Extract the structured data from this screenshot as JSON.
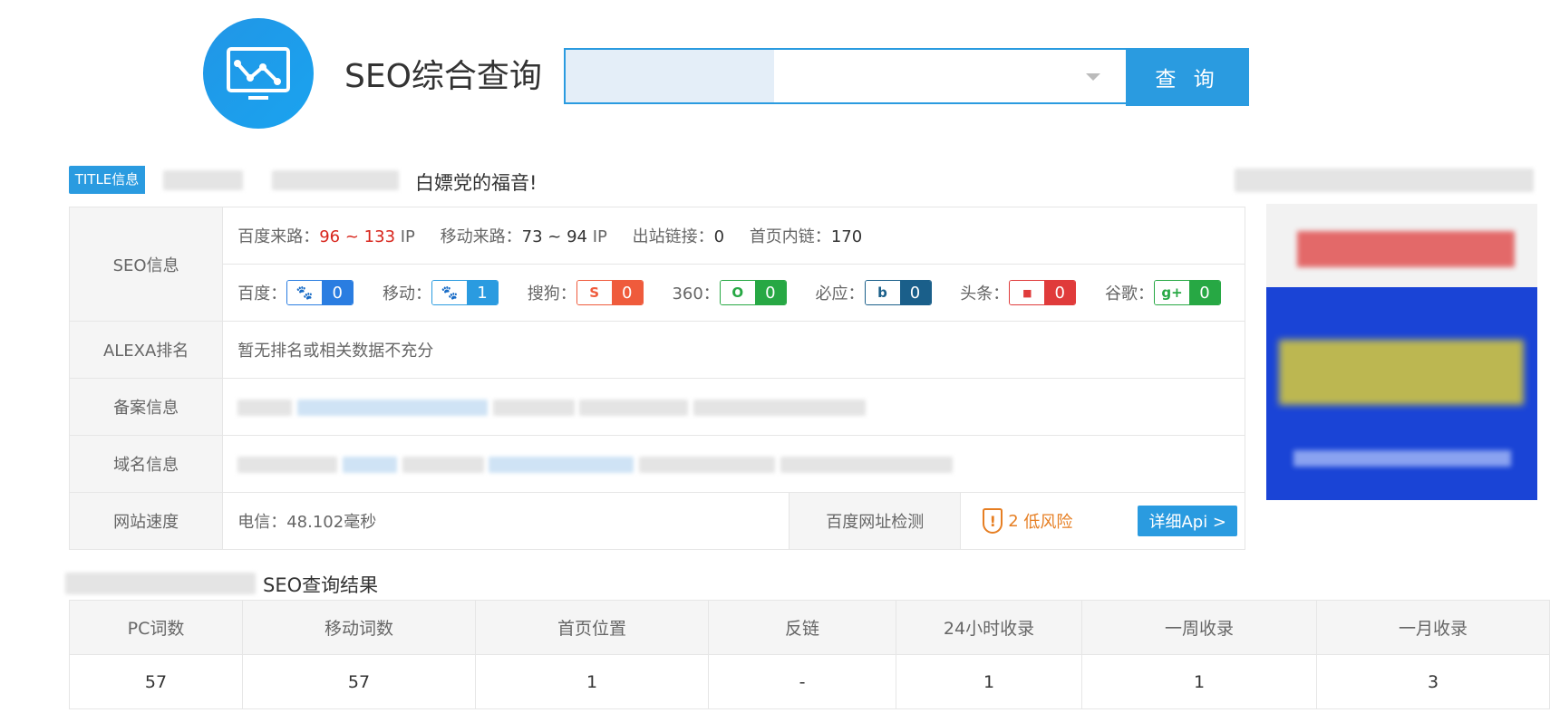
{
  "app": {
    "title": "SEO综合查询"
  },
  "search": {
    "placeholder": "",
    "button_label": "查 询"
  },
  "title_info": {
    "badge": "TITLE信息",
    "text": "白嫖党的福音!"
  },
  "seo_info": {
    "label": "SEO信息",
    "traffic": [
      {
        "label": "百度来路：",
        "value": "96 ~ 133",
        "unit": " IP"
      },
      {
        "label": "移动来路：",
        "value": "73 ~ 94",
        "unit": " IP"
      },
      {
        "label": "出站链接：",
        "value": "0"
      },
      {
        "label": "首页内链：",
        "value": "170"
      }
    ],
    "engines": [
      {
        "label": "百度：",
        "value": "0",
        "icon": "baidu-paw-icon",
        "color": "#2a7de1"
      },
      {
        "label": "移动：",
        "value": "1",
        "icon": "mobile-paw-icon",
        "color": "#2a9be0"
      },
      {
        "label": "搜狗：",
        "value": "0",
        "icon": "sogou-icon",
        "color": "#ef5b3c"
      },
      {
        "label": "360：",
        "value": "0",
        "icon": "360-icon",
        "color": "#27a844"
      },
      {
        "label": "必应：",
        "value": "0",
        "icon": "bing-icon",
        "color": "#1a5f8a"
      },
      {
        "label": "头条：",
        "value": "0",
        "icon": "toutiao-icon",
        "color": "#e03b3b"
      },
      {
        "label": "谷歌：",
        "value": "0",
        "icon": "google-icon",
        "color": "#27a844"
      }
    ]
  },
  "alexa": {
    "label": "ALEXA排名",
    "value": "暂无排名或相关数据不充分"
  },
  "beian": {
    "label": "备案信息"
  },
  "domain": {
    "label": "域名信息"
  },
  "speed": {
    "label": "网站速度",
    "value": "电信：48.102毫秒",
    "check_label": "百度网址检测",
    "risk_count": "2",
    "risk_text": "低风险",
    "api_button": "详细Api >"
  },
  "result": {
    "title": "SEO查询结果",
    "headers": [
      "PC词数",
      "移动词数",
      "首页位置",
      "反链",
      "24小时收录",
      "一周收录",
      "一月收录"
    ],
    "values": [
      "57",
      "57",
      "1",
      "-",
      "1",
      "1",
      "3"
    ]
  },
  "colors": {
    "accent": "#2a9be0",
    "risk": "#e67e22",
    "traffic_red": "#d8261d"
  }
}
